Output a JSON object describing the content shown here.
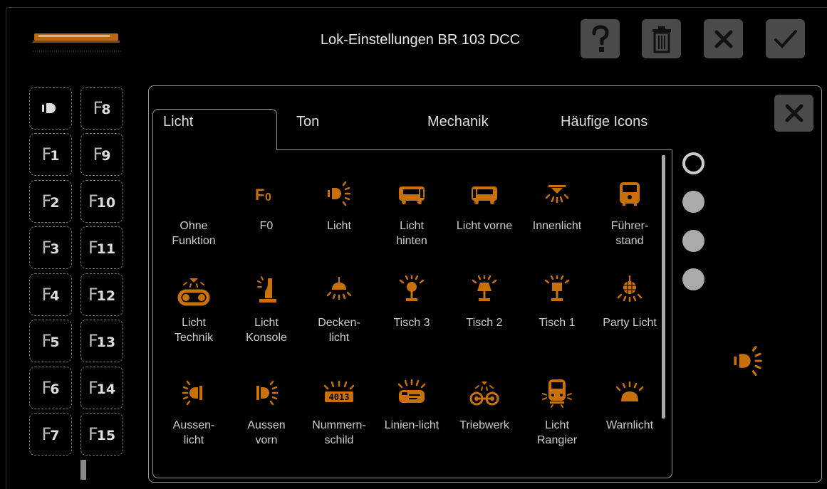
{
  "header": {
    "title": "Lok-Einstellungen BR 103 DCC",
    "buttons": [
      {
        "name": "help-button",
        "icon": "question-icon"
      },
      {
        "name": "delete-button",
        "icon": "trash-icon"
      },
      {
        "name": "cancel-button",
        "icon": "close-icon"
      },
      {
        "name": "confirm-button",
        "icon": "check-icon"
      }
    ]
  },
  "function_slots": {
    "left": [
      "light",
      "F1",
      "F2",
      "F3",
      "F4",
      "F5",
      "F6",
      "F7"
    ],
    "right": [
      "F8",
      "F9",
      "F10",
      "F11",
      "F12",
      "F13",
      "F14",
      "F15"
    ]
  },
  "tabs": [
    {
      "label": "Licht",
      "active": true
    },
    {
      "label": "Ton",
      "active": false
    },
    {
      "label": "Mechanik",
      "active": false
    },
    {
      "label": "Häufige Icons",
      "active": false
    }
  ],
  "icons": [
    {
      "label": "Ohne\nFunktion",
      "icon": "none"
    },
    {
      "label": "F0",
      "icon": "f0-icon"
    },
    {
      "label": "Licht",
      "icon": "light-icon"
    },
    {
      "label": "Licht\nhinten",
      "icon": "light-rear-icon"
    },
    {
      "label": "Licht vorne",
      "icon": "light-front-icon"
    },
    {
      "label": "Innenlicht",
      "icon": "interior-light-icon"
    },
    {
      "label": "Führer-\nstand",
      "icon": "cab-icon"
    },
    {
      "label": "Licht\nTechnik",
      "icon": "light-technik-icon"
    },
    {
      "label": "Licht\nKonsole",
      "icon": "light-console-icon"
    },
    {
      "label": "Decken-\nlicht",
      "icon": "ceiling-light-icon"
    },
    {
      "label": "Tisch 3",
      "icon": "table-lamp-3-icon"
    },
    {
      "label": "Tisch 2",
      "icon": "table-lamp-2-icon"
    },
    {
      "label": "Tisch 1",
      "icon": "table-lamp-1-icon"
    },
    {
      "label": "Party Licht",
      "icon": "disco-ball-icon"
    },
    {
      "label": "Aussen-\nlicht",
      "icon": "outside-light-icon"
    },
    {
      "label": "Aussen\nvorn",
      "icon": "outside-front-icon"
    },
    {
      "label": "Nummern-\nschild",
      "icon": "number-plate-icon"
    },
    {
      "label": "Linien-licht",
      "icon": "line-light-icon"
    },
    {
      "label": "Triebwerk",
      "icon": "drivetrain-icon"
    },
    {
      "label": "Licht\nRangier",
      "icon": "shunting-light-icon"
    },
    {
      "label": "Warnlicht",
      "icon": "warning-light-icon"
    }
  ],
  "number_plate_text": "4013",
  "radios": [
    true,
    false,
    false,
    false
  ],
  "colors": {
    "accent": "#c8700a",
    "button_bg": "#4a4a4a"
  }
}
